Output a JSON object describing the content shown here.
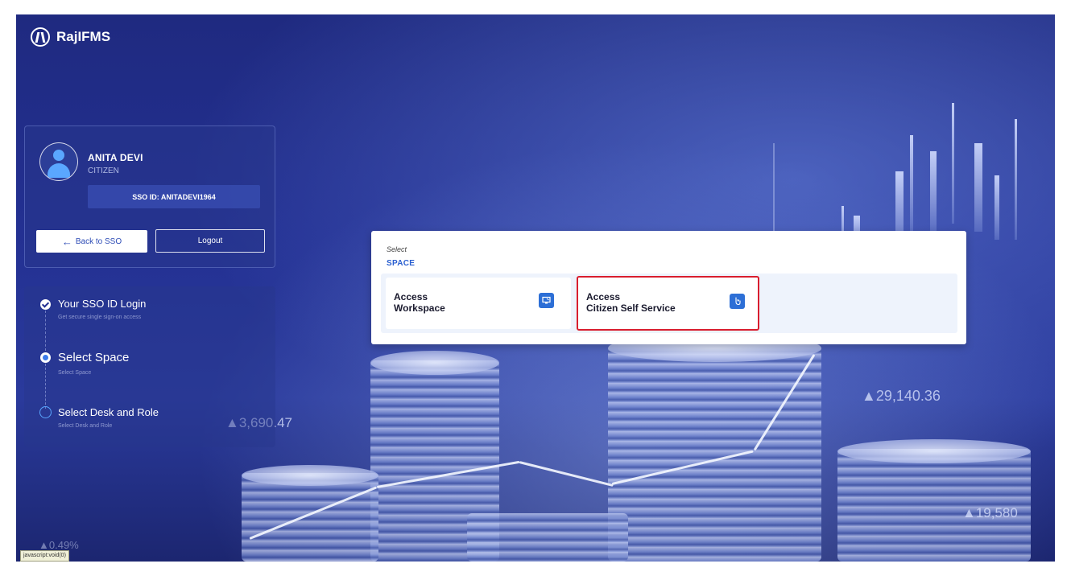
{
  "app": {
    "name": "RajIFMS"
  },
  "profile": {
    "name": "ANITA DEVI",
    "role": "CITIZEN",
    "sso_id": "SSO ID: ANITADEVI1964",
    "back_button": "Back to SSO",
    "logout_button": "Logout"
  },
  "steps": [
    {
      "title": "Your SSO ID Login",
      "subtitle": "Get secure single sign-on access",
      "state": "done"
    },
    {
      "title": "Select Space",
      "subtitle": "Select Space",
      "state": "active"
    },
    {
      "title": "Select Desk and Role",
      "subtitle": "Select Desk and Role",
      "state": "pending"
    }
  ],
  "select_panel": {
    "select_label": "Select",
    "space_label": "SPACE",
    "options": [
      {
        "line1": "Access",
        "line2": "Workspace",
        "icon": "workspace-icon",
        "highlighted": false
      },
      {
        "line1": "Access",
        "line2": "Citizen Self Service",
        "icon": "citizen-service-icon",
        "highlighted": true
      }
    ]
  },
  "background_numbers": {
    "left": "▲3,690.47",
    "right_top": "▲29,140.36",
    "right_bottom": "▲19,580",
    "bottom_left": "▲0.49%"
  },
  "status_bar": {
    "text": "javascript:void(0)"
  },
  "colors": {
    "accent": "#2d6fd6",
    "highlight_border": "#d91e2e",
    "background": "#233092"
  }
}
